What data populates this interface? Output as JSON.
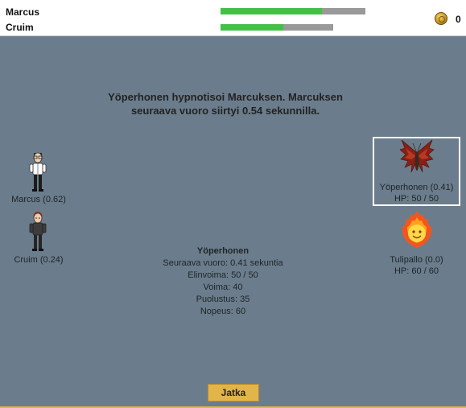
{
  "party": [
    {
      "name": "Marcus",
      "hp_fraction": 0.7
    },
    {
      "name": "Cruim",
      "hp_fraction": 0.56
    }
  ],
  "gold": {
    "amount": "0",
    "icon": "coin-icon"
  },
  "battle_message": "Yöperhonen hypnotisoi Marcuksen. Marcuksen seuraava vuoro siirtyi 0.54 sekunnilla.",
  "heroes": [
    {
      "label": "Marcus (0.62)"
    },
    {
      "label": "Cruim (0.24)"
    }
  ],
  "enemies": [
    {
      "label": "Yöperhonen (0.41)",
      "hp": "HP: 50 / 50",
      "selected": true
    },
    {
      "label": "Tulipallo (0.0)",
      "hp": "HP: 60 / 60",
      "selected": false
    }
  ],
  "info": {
    "title": "Yöperhonen",
    "lines": [
      "Seuraava vuoro: 0.41 sekuntia",
      "Elinvoima: 50 / 50",
      "Voima: 40",
      "Puolustus: 35",
      "Nopeus: 60"
    ]
  },
  "continue_label": "Jatka",
  "colors": {
    "background": "#6b7d8c",
    "hp_fill": "#44c047",
    "hp_empty": "#999999",
    "button": "#e2b54b"
  }
}
